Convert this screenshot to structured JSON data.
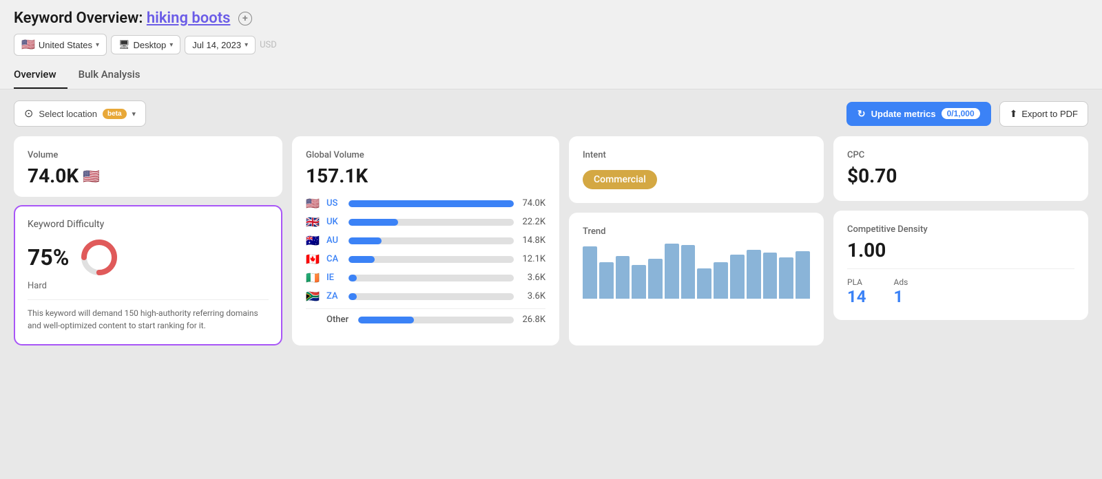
{
  "header": {
    "title_prefix": "Keyword Overview:",
    "keyword": "hiking boots",
    "add_icon_label": "+"
  },
  "filters": {
    "location": "United States",
    "location_flag": "🇺🇸",
    "device": "Desktop",
    "device_icon": "🖥",
    "date": "Jul 14, 2023",
    "currency": "USD"
  },
  "tabs": [
    {
      "label": "Overview",
      "active": true
    },
    {
      "label": "Bulk Analysis",
      "active": false
    }
  ],
  "toolbar": {
    "select_location_label": "Select location",
    "beta_label": "beta",
    "update_metrics_label": "Update metrics",
    "metrics_count": "0/1,000",
    "export_label": "Export to PDF"
  },
  "volume_card": {
    "label": "Volume",
    "value": "74.0K",
    "flag": "🇺🇸"
  },
  "kd_card": {
    "label": "Keyword Difficulty",
    "percent": "75%",
    "difficulty": "Hard",
    "description": "This keyword will demand 150 high-authority referring domains and well-optimized content to start ranking for it.",
    "donut_value": 75,
    "donut_color": "#e05a5a",
    "donut_bg": "#e0e0e0"
  },
  "global_volume_card": {
    "label": "Global Volume",
    "value": "157.1K",
    "countries": [
      {
        "flag": "🇺🇸",
        "code": "US",
        "value": "74.0K",
        "pct": 100
      },
      {
        "flag": "🇬🇧",
        "code": "UK",
        "value": "22.2K",
        "pct": 30
      },
      {
        "flag": "🇦🇺",
        "code": "AU",
        "value": "14.8K",
        "pct": 20
      },
      {
        "flag": "🇨🇦",
        "code": "CA",
        "value": "12.1K",
        "pct": 16
      },
      {
        "flag": "🇮🇪",
        "code": "IE",
        "value": "3.6K",
        "pct": 5
      },
      {
        "flag": "🇿🇦",
        "code": "ZA",
        "value": "3.6K",
        "pct": 5
      }
    ],
    "other_label": "Other",
    "other_value": "26.8K",
    "other_pct": 36
  },
  "intent_card": {
    "label": "Intent",
    "value": "Commercial"
  },
  "trend_card": {
    "label": "Trend",
    "bars": [
      85,
      60,
      70,
      55,
      65,
      90,
      88,
      50,
      60,
      72,
      80,
      75,
      68,
      78
    ]
  },
  "cpc_card": {
    "label": "CPC",
    "value": "$0.70"
  },
  "competitive_card": {
    "label": "Competitive Density",
    "value": "1.00",
    "pla_label": "PLA",
    "pla_value": "14",
    "ads_label": "Ads",
    "ads_value": "1"
  }
}
